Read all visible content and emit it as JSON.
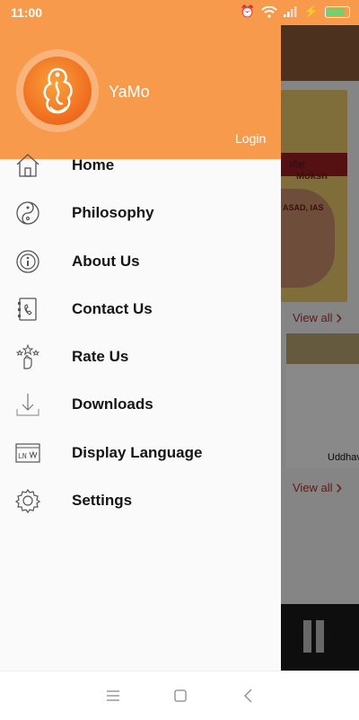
{
  "status_bar": {
    "time": "11:00"
  },
  "drawer": {
    "user_name": "YaMo",
    "login_label": "Login",
    "menu": [
      {
        "label": "Home",
        "icon": "home-icon"
      },
      {
        "label": "Philosophy",
        "icon": "yin-yang-icon"
      },
      {
        "label": "About Us",
        "icon": "info-icon"
      },
      {
        "label": "Contact Us",
        "icon": "contact-phone-icon"
      },
      {
        "label": "Rate Us",
        "icon": "rate-hand-icon"
      },
      {
        "label": "Downloads",
        "icon": "download-icon"
      },
      {
        "label": "Display Language",
        "icon": "language-icon"
      },
      {
        "label": "Settings",
        "icon": "gear-icon"
      }
    ]
  },
  "background": {
    "banner_text_1": "मोक्ष",
    "banner_text_2": "Moksh",
    "banner_text_3": "ASAD, IAS",
    "view_all_1": "View all",
    "view_all_2": "View all",
    "card_caption": "Uddhav"
  },
  "colors": {
    "accent": "#f79a4b",
    "text": "#151515"
  }
}
